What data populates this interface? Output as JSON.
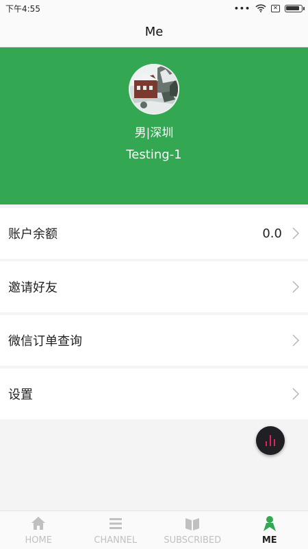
{
  "status_bar": {
    "time": "下午4:55",
    "dots": "•••",
    "battery_level": 0.9
  },
  "header": {
    "title": "Me"
  },
  "profile": {
    "meta": "男|深圳",
    "name": "Testing-1"
  },
  "menu": {
    "balance_label": "账户余额",
    "balance_value": "0.0",
    "invite_label": "邀请好友",
    "wechat_orders_label": "微信订单查询",
    "settings_label": "设置"
  },
  "tabs": [
    {
      "label": "HOME",
      "icon": "home-icon",
      "active": false
    },
    {
      "label": "CHANNEL",
      "icon": "channel-icon",
      "active": false
    },
    {
      "label": "SUBSCRIBED",
      "icon": "subscribed-icon",
      "active": false
    },
    {
      "label": "ME",
      "icon": "me-icon",
      "active": true
    }
  ],
  "colors": {
    "accent": "#33a752",
    "inactive_tab": "#c0c0c0",
    "fab_bars": "#e0245e"
  }
}
